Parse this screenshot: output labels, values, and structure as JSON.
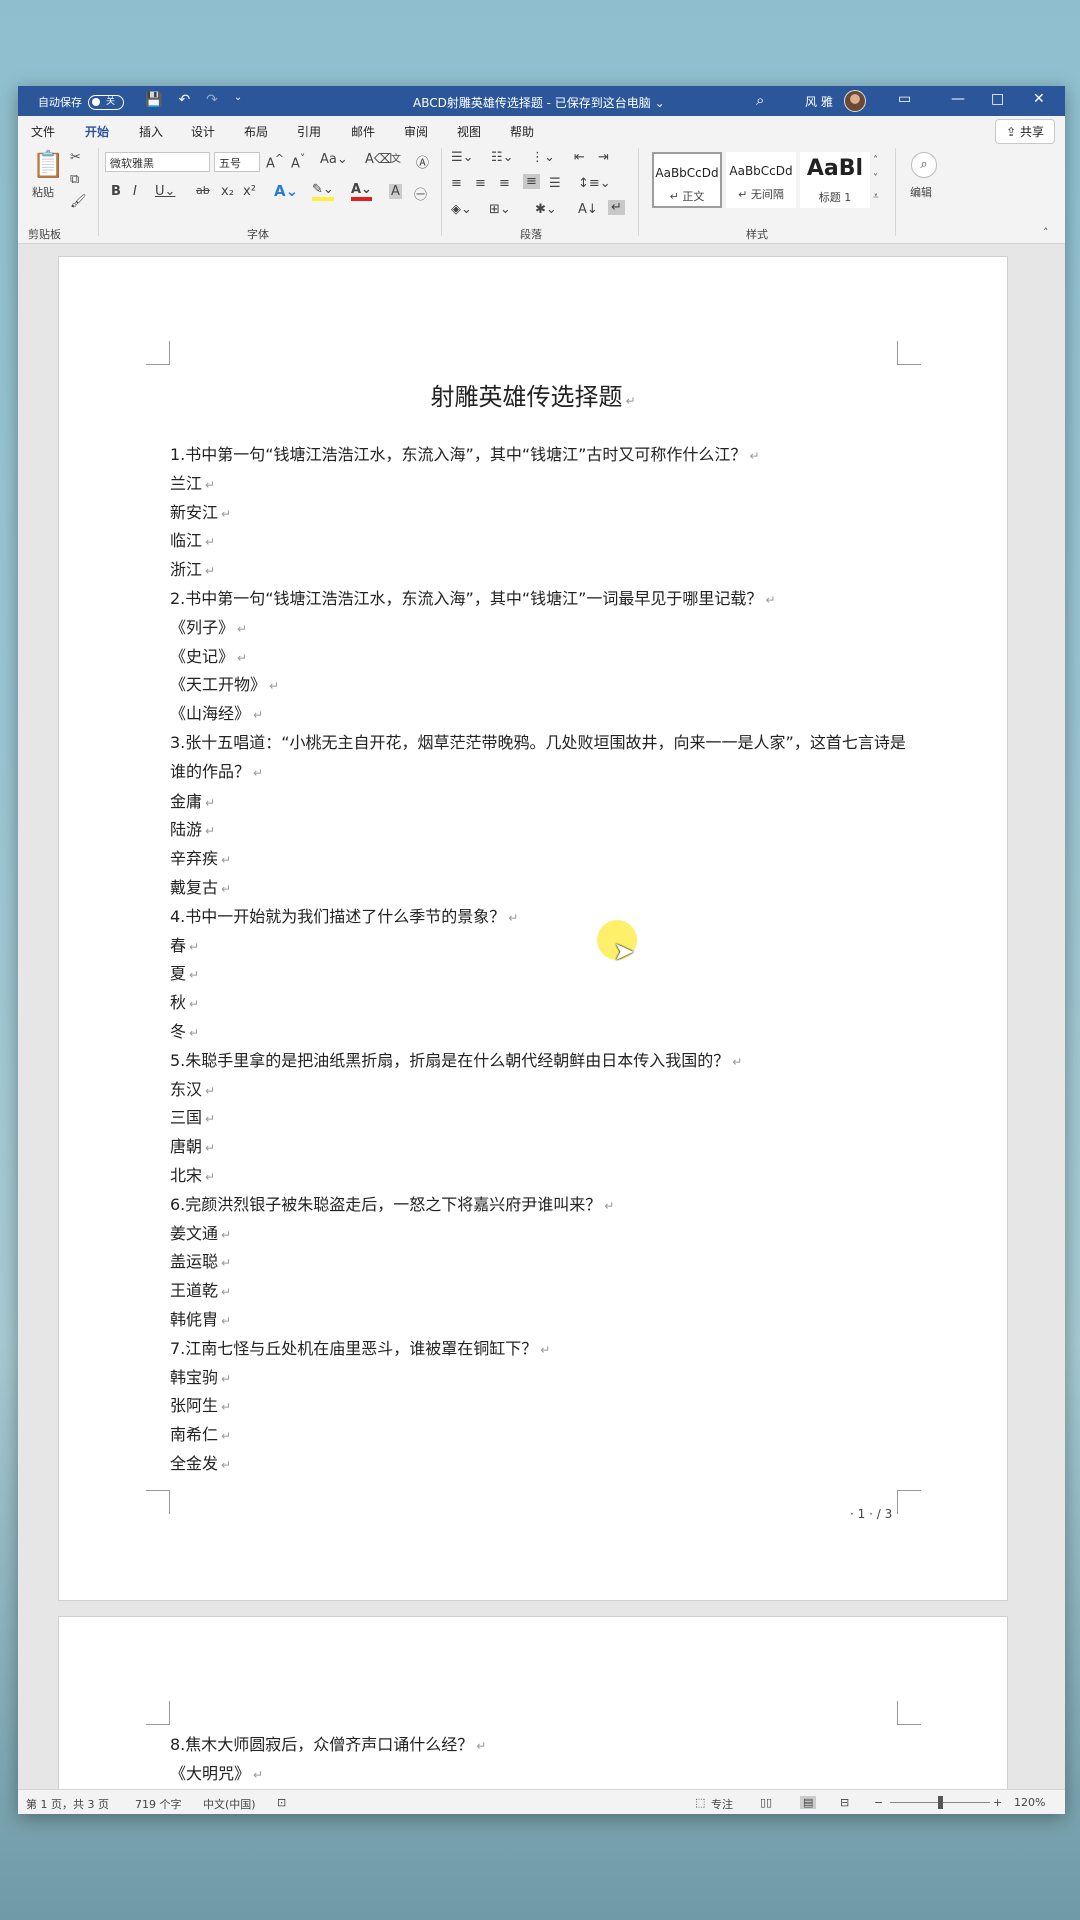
{
  "titlebar": {
    "autosave_label": "自动保存",
    "autosave_state": "关",
    "doc_title": "ABCD射雕英雄传选择题 - 已保存到这台电脑 ⌄",
    "user_name": "风 雅",
    "icons": [
      "save-icon",
      "undo-icon",
      "redo-icon",
      "customize-icon",
      "search-icon",
      "ribbon-display-icon",
      "minimize-icon",
      "maximize-icon",
      "close-icon"
    ]
  },
  "menu": {
    "tabs": [
      "文件",
      "开始",
      "插入",
      "设计",
      "布局",
      "引用",
      "邮件",
      "审阅",
      "视图",
      "帮助"
    ],
    "active_tab": "开始",
    "share_label": "共享"
  },
  "ribbon": {
    "clipboard": {
      "paste_label": "粘贴",
      "group_label": "剪贴板"
    },
    "font": {
      "font_name": "微软雅黑",
      "font_size": "五号",
      "group_label": "字体",
      "buttons": [
        "A^",
        "A˅",
        "Aa",
        "B",
        "I",
        "U",
        "ab",
        "x₂",
        "x²"
      ]
    },
    "paragraph": {
      "group_label": "段落"
    },
    "styles": {
      "group_label": "样式",
      "items": [
        {
          "sample": "AaBbCcDd",
          "name": "↵ 正文"
        },
        {
          "sample": "AaBbCcDd",
          "name": "↵ 无间隔"
        },
        {
          "sample": "AaBl",
          "name": "标题 1"
        }
      ]
    },
    "editing": {
      "label": "编辑"
    }
  },
  "document": {
    "title": "射雕英雄传选择题",
    "page1_lines": [
      "1.书中第一句“钱塘江浩浩江水，东流入海”，其中“钱塘江”古时又可称作什么江？",
      "兰江",
      "新安江",
      "临江",
      "浙江",
      "2.书中第一句“钱塘江浩浩江水，东流入海”，其中“钱塘江”一词最早见于哪里记载？",
      "《列子》",
      "《史记》",
      "《天工开物》",
      "《山海经》",
      "3.张十五唱道：“小桃无主自开花，烟草茫茫带晚鸦。几处败垣围故井，向来一一是人家”，这首七言诗是谁的作品？",
      "金庸",
      "陆游",
      "辛弃疾",
      "戴复古",
      "4.书中一开始就为我们描述了什么季节的景象？",
      "春",
      "夏",
      "秋",
      "冬",
      "5.朱聪手里拿的是把油纸黑折扇，折扇是在什么朝代经朝鲜由日本传入我国的？",
      "东汉",
      "三国",
      "唐朝",
      "北宋",
      "6.完颜洪烈银子被朱聪盗走后，一怒之下将嘉兴府尹谁叫来？",
      "姜文通",
      "盖运聪",
      "王道乾",
      "韩侂胄",
      "7.江南七怪与丘处机在庙里恶斗，谁被罩在铜缸下？",
      "韩宝驹",
      "张阿生",
      "南希仁",
      "全金发"
    ],
    "page_number": "· 1 · / 3",
    "page2_lines": [
      "8.焦木大师圆寂后，众僧齐声口诵什么经？",
      "《大明咒》"
    ],
    "paragraph_mark": "↵"
  },
  "statusbar": {
    "page_info": "第 1 页，共 3 页",
    "word_count": "719 个字",
    "language": "中文(中国)",
    "focus_label": "专注",
    "zoom": "120%"
  }
}
